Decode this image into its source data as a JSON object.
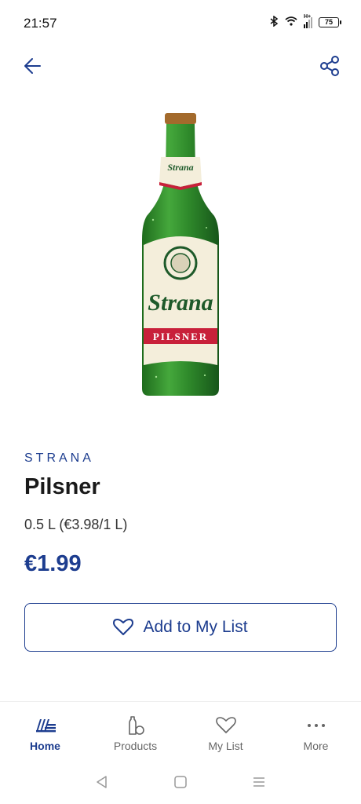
{
  "status_bar": {
    "time": "21:57",
    "network": "H+",
    "battery": "75"
  },
  "header": {
    "back_icon": "arrow-left-icon",
    "share_icon": "share-icon"
  },
  "product": {
    "brand": "STRANA",
    "name": "Pilsner",
    "size": "0.5 L (€3.98/1 L)",
    "price": "€1.99",
    "image_label_brand": "Strana",
    "image_label_type": "PILSNER"
  },
  "actions": {
    "add_to_list_label": "Add to My List",
    "add_to_list_icon": "heart-icon"
  },
  "bottom_nav": {
    "items": [
      {
        "label": "Home",
        "icon": "home-logo-icon",
        "active": true
      },
      {
        "label": "Products",
        "icon": "products-icon",
        "active": false
      },
      {
        "label": "My List",
        "icon": "heart-icon",
        "active": false
      },
      {
        "label": "More",
        "icon": "more-dots-icon",
        "active": false
      }
    ]
  },
  "colors": {
    "brand_blue": "#1d3d8f",
    "bottle_green": "#2f8a2b",
    "label_red": "#c8203a",
    "label_cream": "#f4eedb"
  }
}
